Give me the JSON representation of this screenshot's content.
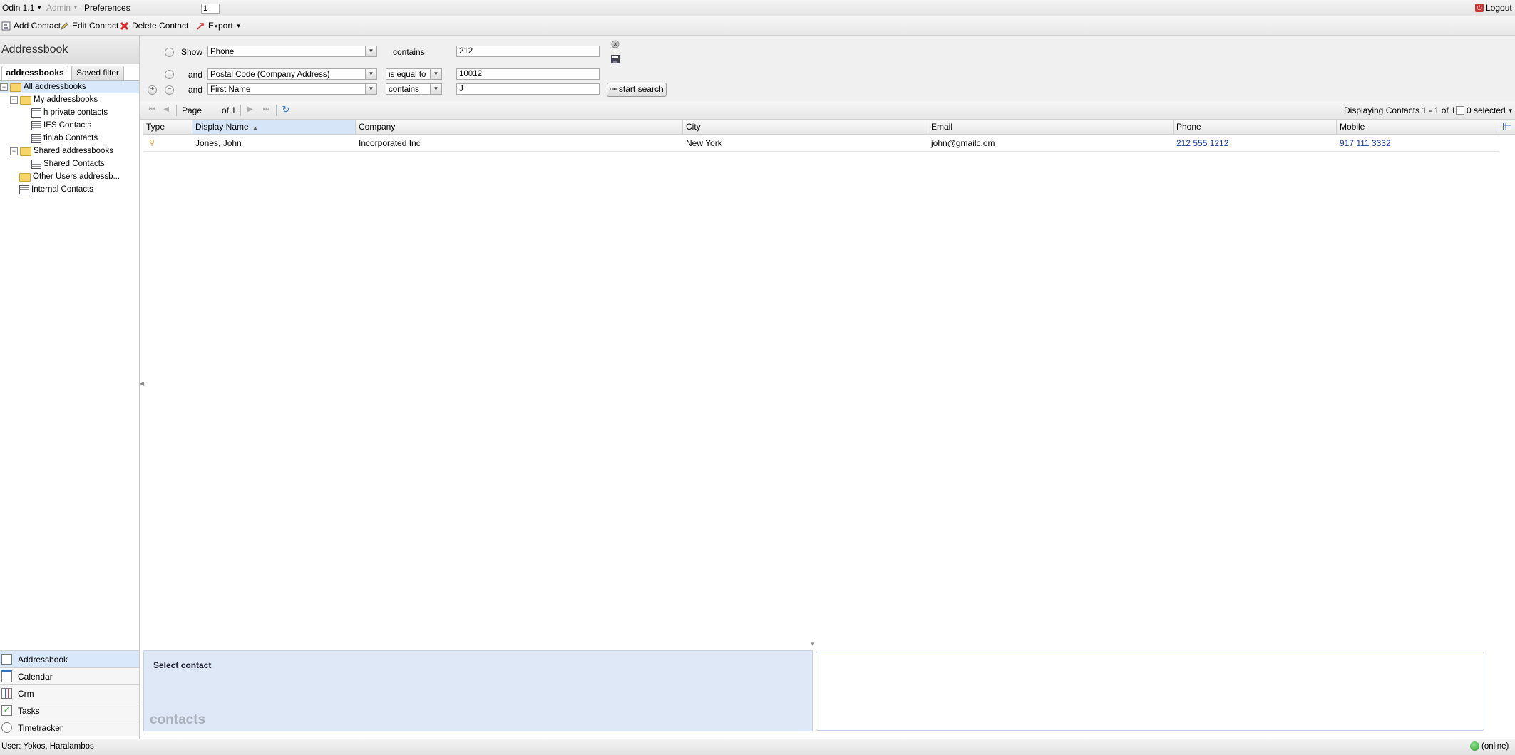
{
  "menubar": {
    "app_menu": "Odin 1.1",
    "admin_menu": "Admin",
    "preferences": "Preferences",
    "logout": "Logout"
  },
  "toolbar": {
    "add_contact": "Add Contact",
    "edit_contact": "Edit Contact",
    "delete_contact": "Delete Contact",
    "export": "Export"
  },
  "left": {
    "title": "Addressbook",
    "tabs": [
      "addressbooks",
      "Saved filter"
    ],
    "tree": {
      "all": "All addressbooks",
      "my": "My addressbooks",
      "my_items": [
        "h private contacts",
        "IES Contacts",
        "tinlab Contacts"
      ],
      "shared": "Shared addressbooks",
      "shared_items": [
        "Shared Contacts"
      ],
      "other": "Other Users addressb...",
      "internal": "Internal Contacts"
    },
    "nav": [
      "Addressbook",
      "Calendar",
      "Crm",
      "Tasks",
      "Timetracker"
    ]
  },
  "search": {
    "rows": [
      {
        "conj": "Show",
        "field": "Phone",
        "operator": "contains",
        "value": "212"
      },
      {
        "conj": "and",
        "field": "Postal Code (Company Address)",
        "operator": "is equal to",
        "value": "10012"
      },
      {
        "conj": "and",
        "field": "First Name",
        "operator": "contains",
        "value": "J"
      }
    ],
    "start_search": "start search"
  },
  "pager": {
    "page_label": "Page",
    "page": "1",
    "of": "of 1",
    "displaying": "Displaying Contacts 1 - 1 of 1",
    "selected": "0 selected"
  },
  "grid": {
    "columns": [
      "Type",
      "Display Name",
      "Company",
      "City",
      "Email",
      "Phone",
      "Mobile"
    ],
    "rows": [
      {
        "display_name": "Jones, John",
        "company": "Incorporated Inc",
        "city": "New York",
        "email": "john@gmailc.om",
        "phone": "212 555 1212",
        "mobile": "917 111 3332"
      }
    ]
  },
  "detail": {
    "select_contact": "Select contact",
    "app_label": "contacts"
  },
  "status": {
    "user": "User: Yokos, Haralambos",
    "online": "(online)"
  },
  "colors": {
    "selection": "#d9e8fb",
    "detail_bg": "#dfe8f6",
    "link": "#1a3aa0",
    "online": "#2aa02a"
  }
}
